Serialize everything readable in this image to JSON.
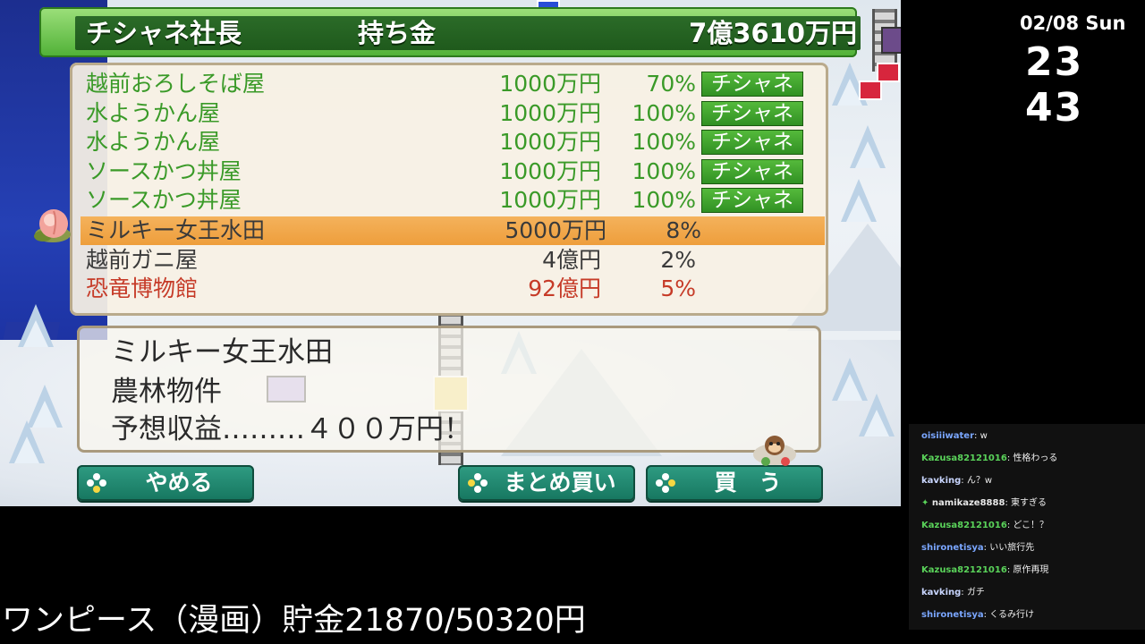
{
  "header": {
    "player": "チシャネ社長",
    "money_label": "持ち金",
    "money_value": "7億3610万円"
  },
  "properties": [
    {
      "name": "越前おろしそば屋",
      "price": "1000万円",
      "percent": "70%",
      "owner": "チシャネ",
      "color": "green"
    },
    {
      "name": "水ようかん屋",
      "price": "1000万円",
      "percent": "100%",
      "owner": "チシャネ",
      "color": "green"
    },
    {
      "name": "水ようかん屋",
      "price": "1000万円",
      "percent": "100%",
      "owner": "チシャネ",
      "color": "green"
    },
    {
      "name": "ソースかつ丼屋",
      "price": "1000万円",
      "percent": "100%",
      "owner": "チシャネ",
      "color": "green"
    },
    {
      "name": "ソースかつ丼屋",
      "price": "1000万円",
      "percent": "100%",
      "owner": "チシャネ",
      "color": "green"
    },
    {
      "name": "ミルキー女王水田",
      "price": "5000万円",
      "percent": "8%",
      "owner": "",
      "color": "dark",
      "selected": true
    },
    {
      "name": "越前ガニ屋",
      "price": "4億円",
      "percent": "2%",
      "owner": "",
      "color": "dark"
    },
    {
      "name": "恐竜博物館",
      "price": "92億円",
      "percent": "5%",
      "owner": "",
      "color": "red"
    }
  ],
  "info": {
    "name": "ミルキー女王水田",
    "category": "農林物件",
    "earnings": "予想収益………４００万円！"
  },
  "buttons": {
    "cancel": "やめる",
    "bulk_buy": "まとめ買い",
    "buy": "買　う"
  },
  "overlay": {
    "date": "02/08 Sun",
    "time": "23 43",
    "bottom_text": "ワンピース（漫画）貯金21870/50320円"
  },
  "chat": [
    {
      "user": "oisiiiwater",
      "text": ": w",
      "color": "#7aa6ff"
    },
    {
      "user": "Kazusa82121016",
      "text": ": 性格わっる",
      "color": "#5ad35a"
    },
    {
      "user": "kavking",
      "text": ": ん？w",
      "color": "#c9d6ff"
    },
    {
      "user": "namikaze8888",
      "text": ": 東すぎる",
      "color": "#e8e8e8",
      "badge": true
    },
    {
      "user": "Kazusa82121016",
      "text": ": どこ！？",
      "color": "#5ad35a"
    },
    {
      "user": "shironetisya",
      "text": ": いい旅行先",
      "color": "#7aa6ff"
    },
    {
      "user": "Kazusa82121016",
      "text": ": 原作再現",
      "color": "#5ad35a"
    },
    {
      "user": "kavking",
      "text": ": ガチ",
      "color": "#c9d6ff"
    },
    {
      "user": "shironetisya",
      "text": ": くるみ行け",
      "color": "#7aa6ff"
    }
  ]
}
